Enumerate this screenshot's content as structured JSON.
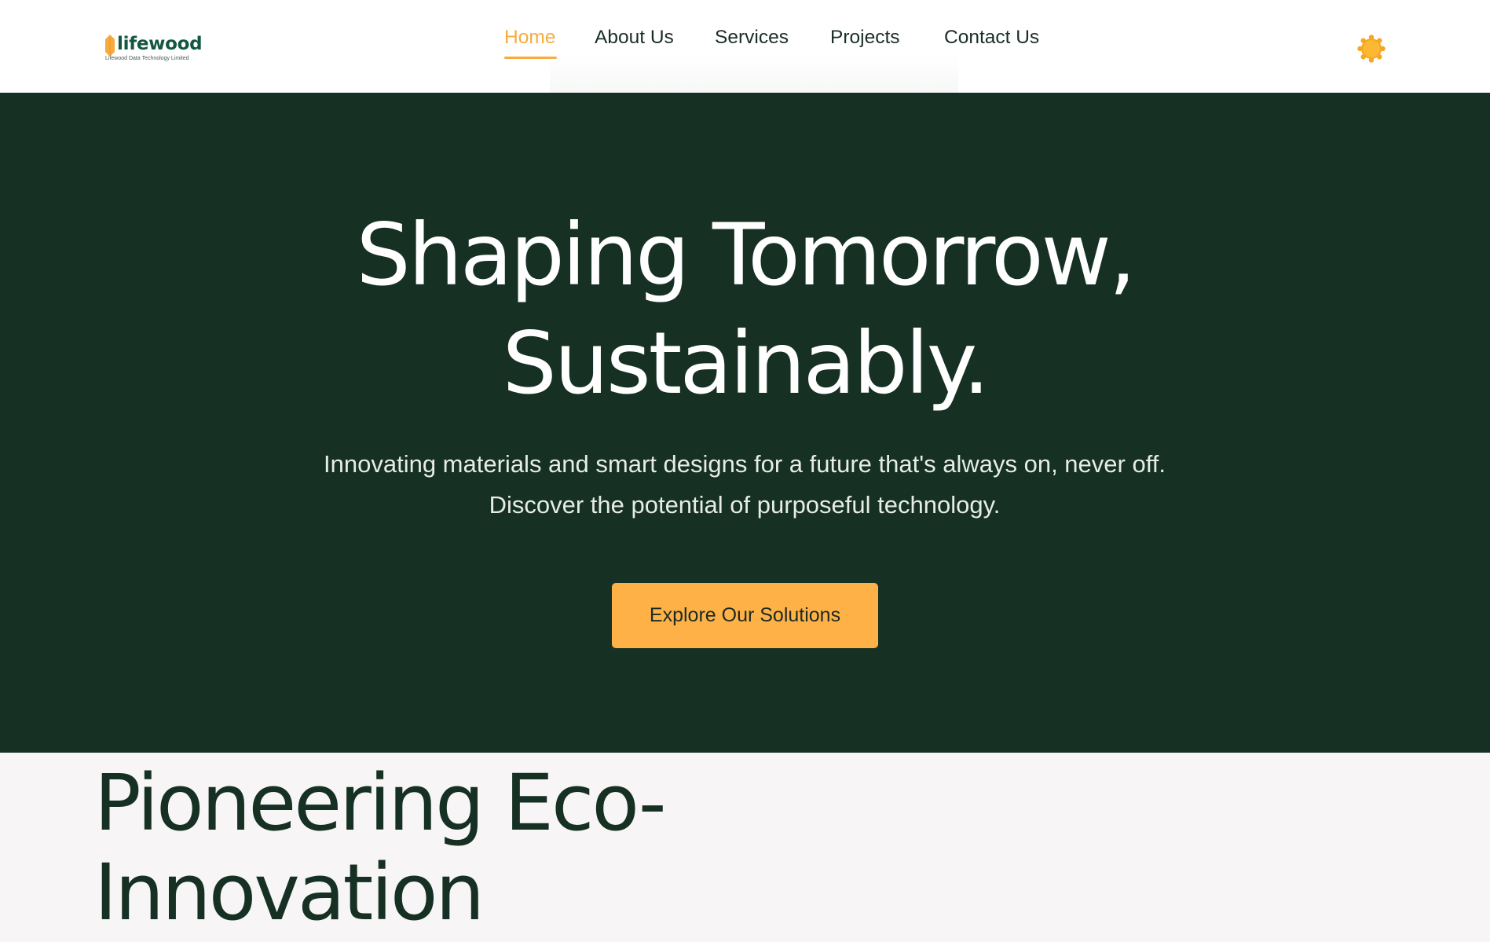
{
  "brand": {
    "name": "lifewood",
    "tagline": "Lifewood Data Technology Limited",
    "logo_icon": "leaf-mark-icon",
    "name_color": "#12573e",
    "mark_color": "#f7ab3e"
  },
  "nav": {
    "items": [
      {
        "label": "Home",
        "active": true
      },
      {
        "label": "About Us",
        "active": false
      },
      {
        "label": "Services",
        "active": false
      },
      {
        "label": "Projects",
        "active": false
      },
      {
        "label": "Contact Us",
        "active": false
      }
    ],
    "active_color": "#f7ab3e"
  },
  "theme_toggle": {
    "icon": "sun-icon",
    "color": "#f7ab3e"
  },
  "hero": {
    "title_line1": "Shaping Tomorrow,",
    "title_line2": "Sustainably.",
    "subtitle": "Innovating materials and smart designs for a future that's always on, never off. Discover the potential of purposeful technology.",
    "cta_label": "Explore Our Solutions",
    "background": "#163023",
    "cta_color": "#fdb146"
  },
  "eco_section": {
    "title_line1": "Pioneering Eco-",
    "title_line2": "Innovation"
  }
}
